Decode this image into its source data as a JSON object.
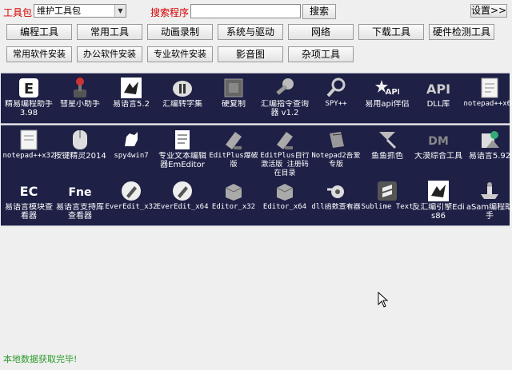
{
  "toolbar": {
    "toolkit_label": "工具包",
    "toolkit_value": "维护工具包",
    "search_label": "搜索程序",
    "search_value": "",
    "search_button": "搜索",
    "settings_button": "设置>>"
  },
  "categories_row1": [
    "编程工具",
    "常用工具",
    "动画录制",
    "系统与驱动",
    "网络",
    "下载工具",
    "硬件检测工具"
  ],
  "categories_row2": [
    "常用软件安装",
    "办公软件安装",
    "专业软件安装",
    "影音图",
    "杂项工具"
  ],
  "panel1": [
    {
      "label": "精易编程助手3.98",
      "icon": "e-logo-icon"
    },
    {
      "label": "彗星小助手",
      "icon": "joystick-icon"
    },
    {
      "label": "易语言5.2",
      "icon": "bird-icon"
    },
    {
      "label": "汇编转字集",
      "icon": "pill-icon"
    },
    {
      "label": "硬复制",
      "icon": "chip-icon"
    },
    {
      "label": "汇编指令查询器 v1.2",
      "icon": "wrench-icon"
    },
    {
      "label": "SPY++",
      "icon": "magnifier-icon"
    },
    {
      "label": "易用api伴侣",
      "icon": "api-star-icon"
    },
    {
      "label": "DLL库",
      "icon": "api-text-icon"
    },
    {
      "label": "notepad++x64",
      "icon": "notepad-icon"
    }
  ],
  "panel2_row1": [
    {
      "label": "notepad++x32",
      "icon": "notepad-icon"
    },
    {
      "label": "按键精灵2014",
      "icon": "mouse-icon"
    },
    {
      "label": "spy4win7",
      "icon": "dog-icon"
    },
    {
      "label": "专业文本编辑器EmEditor",
      "icon": "document-icon"
    },
    {
      "label": "EditPlus爆破版",
      "icon": "edit-icon"
    },
    {
      "label": "EditPlus自行激活版 注册码在目录",
      "icon": "edit-icon"
    },
    {
      "label": "Notepad2吾爱专版",
      "icon": "notepad2-icon"
    },
    {
      "label": "鱼鱼抓色",
      "icon": "color-picker-icon"
    },
    {
      "label": "大漠综合工具",
      "icon": "dm-icon"
    },
    {
      "label": "易语言5.92",
      "icon": "installer-icon"
    }
  ],
  "panel2_row2": [
    {
      "label": "易语言模块查看器",
      "icon": "ec-icon"
    },
    {
      "label": "易语言支持库查看器",
      "icon": "fne-icon"
    },
    {
      "label": "EverEdit_x32",
      "icon": "pencil-circle-icon"
    },
    {
      "label": "EverEdit_x64",
      "icon": "pencil-circle-icon"
    },
    {
      "label": "Editor_x32",
      "icon": "box-icon"
    },
    {
      "label": "Editor_x64",
      "icon": "box-icon"
    },
    {
      "label": "dll函数查看器",
      "icon": "blender-icon"
    },
    {
      "label": "Sublime Text",
      "icon": "sublime-icon"
    },
    {
      "label": "反汇编引擎Edis86",
      "icon": "bird-icon"
    },
    {
      "label": "aSam编程助手",
      "icon": "ship-icon"
    }
  ],
  "status_text": "本地数据获取完毕!"
}
